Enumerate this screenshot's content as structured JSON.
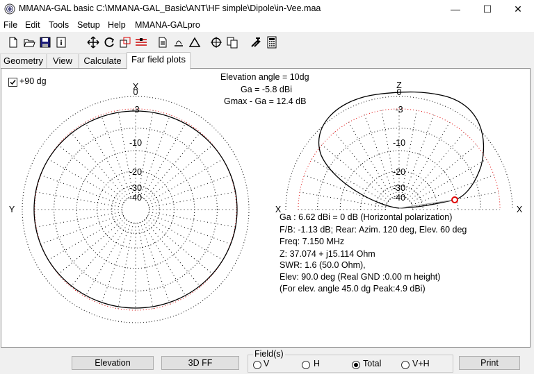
{
  "window": {
    "title": "MMANA-GAL basic C:\\MMANA-GAL_Basic\\ANT\\HF simple\\Dipole\\in-Vee.maa",
    "minimize": "—",
    "maximize": "☐",
    "close": "✕"
  },
  "menu": [
    "File",
    "Edit",
    "Tools",
    "Setup",
    "Help",
    "MMANA-GALpro"
  ],
  "tabs": [
    "Geometry",
    "View",
    "Calculate",
    "Far field plots"
  ],
  "plot": {
    "checkbox_label": "+90 dg",
    "checkbox_checked": true,
    "elevation_angle": "Elevation angle =  10dg",
    "ga": "Ga = -5.8 dBi",
    "gmax": "Gmax - Ga = 12.4 dB",
    "left_axis_top": "X",
    "left_axis_left": "Y",
    "right_axis_top": "Z",
    "right_axis_left": "X",
    "right_axis_right": "X",
    "ring_labels": [
      "0",
      "-3",
      "-10",
      "-20",
      "-30",
      "-40"
    ]
  },
  "info": {
    "line1": "Ga : 6.62 dBi = 0 dB  (Horizontal polarization)",
    "line2": "F/B: -1.13 dB; Rear: Azim. 120 deg,  Elev. 60 deg",
    "line3": "Freq: 7.150 MHz",
    "line4": "Z: 37.074 + j15.114 Ohm",
    "line5": "SWR: 1.6 (50.0 Ohm),",
    "line6": "Elev: 90.0 deg (Real GND  :0.00 m height)",
    "line7": "(For elev. angle 45.0 dg Peak:4.9 dBi)"
  },
  "buttons": {
    "elevation": "Elevation",
    "ff3d": "3D FF",
    "print": "Print"
  },
  "fields": {
    "legend": "Field(s)",
    "options": [
      "V",
      "H",
      "Total",
      "V+H"
    ],
    "selected": "Total"
  },
  "colors": {
    "marker": "#e00000",
    "ref_circle": "#e00000"
  }
}
